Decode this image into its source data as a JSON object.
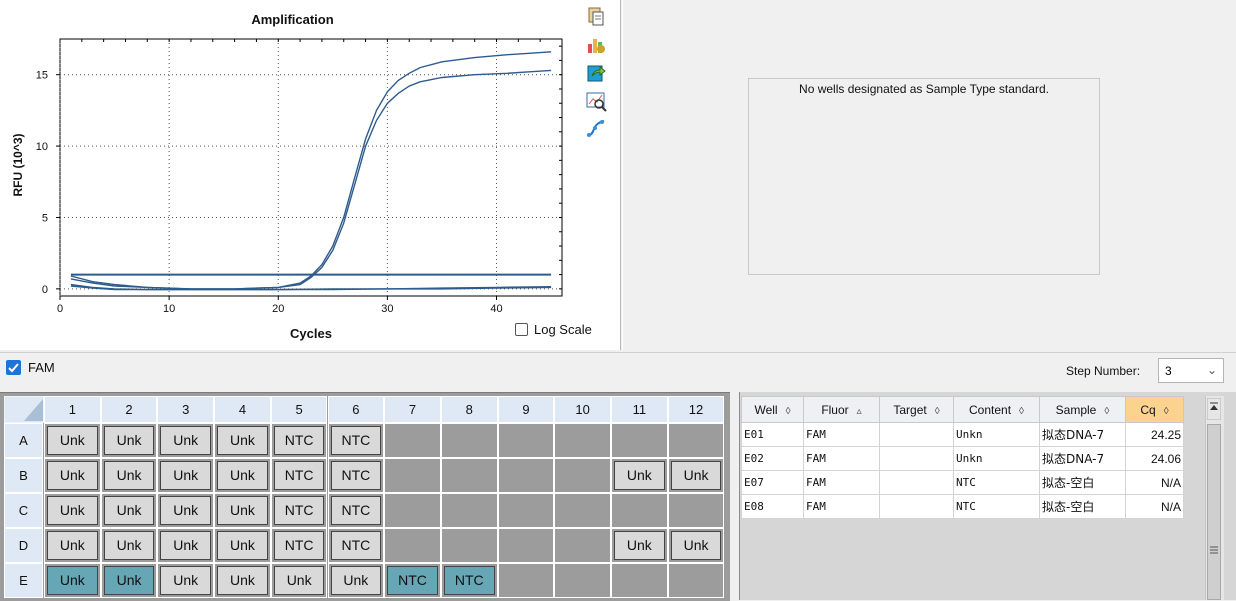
{
  "chart": {
    "title": "Amplification",
    "xlabel": "Cycles",
    "ylabel": "RFU (10^3)",
    "log_scale_label": "Log Scale",
    "log_scale_checked": false
  },
  "chart_data": {
    "type": "line",
    "title": "Amplification",
    "xlabel": "Cycles",
    "ylabel": "RFU (10^3)",
    "xlim": [
      0,
      46
    ],
    "ylim": [
      -0.5,
      17.5
    ],
    "xticks": [
      0,
      10,
      20,
      30,
      40
    ],
    "yticks": [
      0,
      5,
      10,
      15
    ],
    "grid": true,
    "threshold": 1.0,
    "series": [
      {
        "x": [
          1,
          3,
          5,
          8,
          12,
          16,
          20,
          22,
          23,
          24,
          25,
          26,
          27,
          28,
          29,
          30,
          31,
          32,
          33,
          35,
          38,
          41,
          43,
          45
        ],
        "y": [
          0.9,
          0.5,
          0.3,
          0.1,
          0,
          0,
          0.1,
          0.4,
          0.9,
          1.7,
          3.0,
          5.0,
          7.8,
          10.5,
          12.5,
          13.8,
          14.6,
          15.1,
          15.5,
          15.9,
          16.2,
          16.4,
          16.5,
          16.6
        ]
      },
      {
        "x": [
          1,
          3,
          5,
          8,
          12,
          16,
          20,
          22,
          23,
          24,
          25,
          26,
          27,
          28,
          29,
          30,
          31,
          32,
          33,
          35,
          38,
          41,
          43,
          45
        ],
        "y": [
          0.7,
          0.4,
          0.2,
          0.1,
          0,
          0,
          0.1,
          0.3,
          0.8,
          1.5,
          2.7,
          4.6,
          7.3,
          10.0,
          11.8,
          13.0,
          13.7,
          14.2,
          14.5,
          14.8,
          15.0,
          15.1,
          15.2,
          15.3
        ]
      },
      {
        "x": [
          1,
          3,
          5,
          8,
          12,
          16,
          20,
          25,
          30,
          35,
          40,
          45
        ],
        "y": [
          0.3,
          0.1,
          0,
          -0.05,
          -0.05,
          -0.05,
          -0.05,
          0,
          0,
          0.05,
          0.1,
          0.15
        ]
      },
      {
        "x": [
          1,
          3,
          5,
          8,
          12,
          16,
          20,
          25,
          30,
          35,
          40,
          45
        ],
        "y": [
          0.2,
          0.05,
          -0.05,
          -0.05,
          -0.05,
          -0.05,
          -0.05,
          -0.05,
          0,
          0,
          0.05,
          0.1
        ]
      }
    ]
  },
  "standard_panel": {
    "message": "No wells designated as Sample Type standard."
  },
  "fluor_bar": {
    "fluor": "FAM",
    "fam_checked": true,
    "step_label": "Step Number:",
    "step_value": "3"
  },
  "plate": {
    "columns": [
      "1",
      "2",
      "3",
      "4",
      "5",
      "6",
      "7",
      "8",
      "9",
      "10",
      "11",
      "12"
    ],
    "rows": [
      {
        "label": "A",
        "wells": [
          "Unk",
          "Unk",
          "Unk",
          "Unk",
          "NTC",
          "NTC",
          "",
          "",
          "",
          "",
          "",
          ""
        ]
      },
      {
        "label": "B",
        "wells": [
          "Unk",
          "Unk",
          "Unk",
          "Unk",
          "NTC",
          "NTC",
          "",
          "",
          "",
          "",
          "Unk",
          "Unk"
        ]
      },
      {
        "label": "C",
        "wells": [
          "Unk",
          "Unk",
          "Unk",
          "Unk",
          "NTC",
          "NTC",
          "",
          "",
          "",
          "",
          "",
          ""
        ]
      },
      {
        "label": "D",
        "wells": [
          "Unk",
          "Unk",
          "Unk",
          "Unk",
          "NTC",
          "NTC",
          "",
          "",
          "",
          "",
          "Unk",
          "Unk"
        ]
      },
      {
        "label": "E",
        "wells": [
          "Unk",
          "Unk",
          "Unk",
          "Unk",
          "Unk",
          "Unk",
          "NTC",
          "NTC",
          "",
          "",
          "",
          ""
        ]
      }
    ],
    "selected": [
      [
        4,
        0
      ],
      [
        4,
        1
      ],
      [
        4,
        6
      ],
      [
        4,
        7
      ]
    ]
  },
  "table": {
    "headers": [
      {
        "label": "Well",
        "sort": "◊"
      },
      {
        "label": "Fluor",
        "sort": "▵"
      },
      {
        "label": "Target",
        "sort": "◊"
      },
      {
        "label": "Content",
        "sort": "◊"
      },
      {
        "label": "Sample",
        "sort": "◊"
      },
      {
        "label": "Cq",
        "sort": "◊"
      }
    ],
    "rows": [
      [
        "E01",
        "FAM",
        "",
        "Unkn",
        "拟态DNA-7",
        "24.25"
      ],
      [
        "E02",
        "FAM",
        "",
        "Unkn",
        "拟态DNA-7",
        "24.06"
      ],
      [
        "E07",
        "FAM",
        "",
        "NTC",
        "拟态-空白",
        "N/A"
      ],
      [
        "E08",
        "FAM",
        "",
        "NTC",
        "拟态-空白",
        "N/A"
      ]
    ]
  },
  "colors": {
    "line": "#2e5b8d",
    "accent": "#1e74d6",
    "selected_well": "#66a6b5",
    "cq_header": "#fbd38f"
  },
  "icons": [
    "copy-icon",
    "chart-settings-icon",
    "export-icon",
    "zoom-chart-icon",
    "curve-fit-icon"
  ]
}
